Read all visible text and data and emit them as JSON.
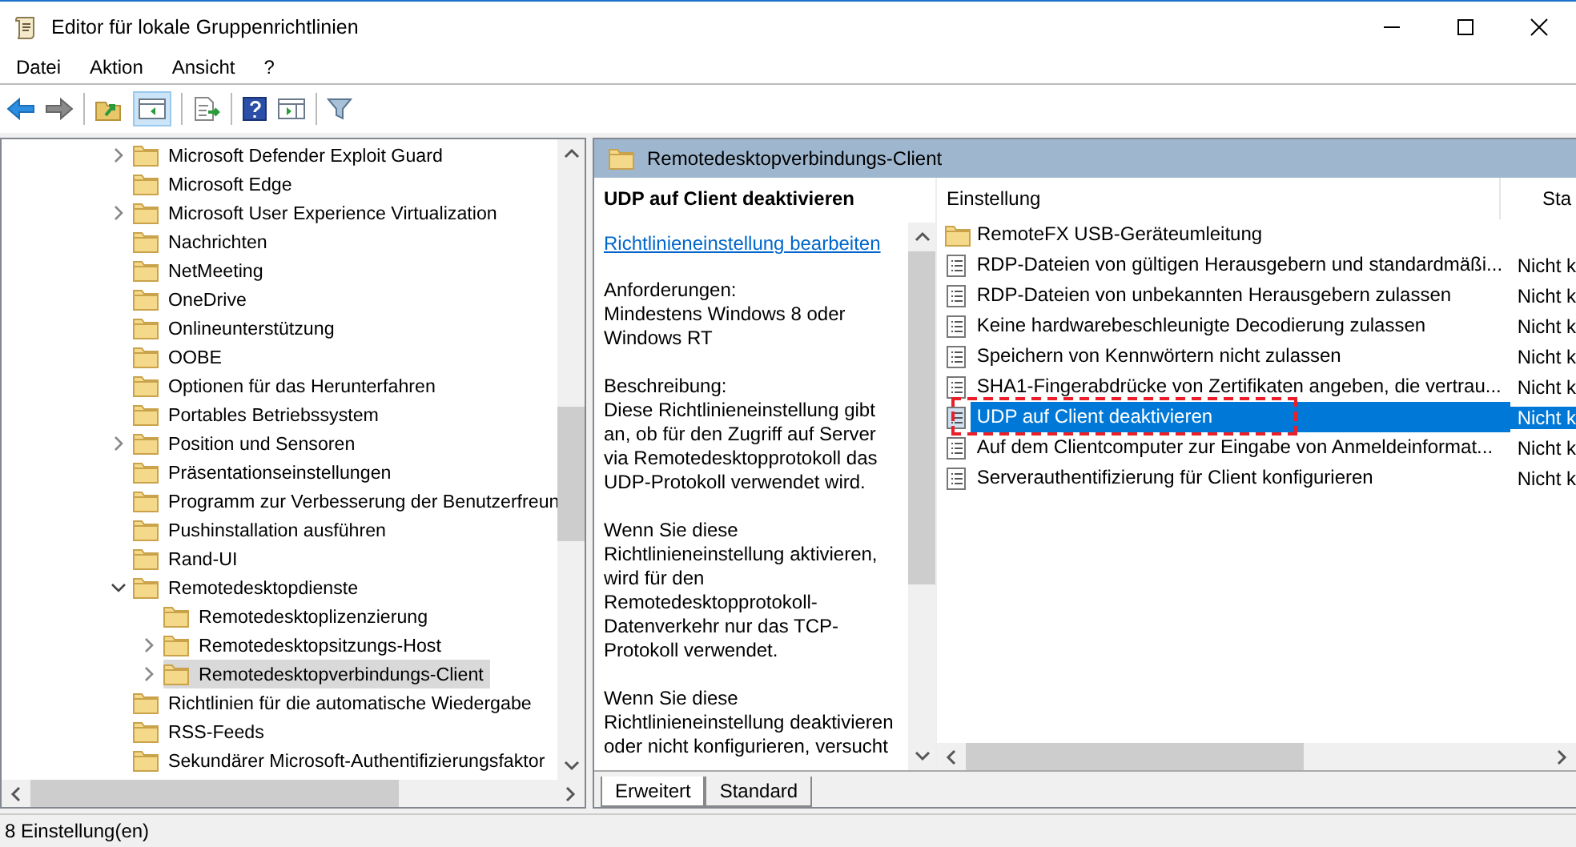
{
  "window": {
    "title": "Editor für lokale Gruppenrichtlinien"
  },
  "menu": [
    "Datei",
    "Aktion",
    "Ansicht",
    "?"
  ],
  "tree": {
    "items": [
      {
        "label": "Microsoft Defender Exploit Guard",
        "expandable": true,
        "expanded": false,
        "selected": false
      },
      {
        "label": "Microsoft Edge",
        "expandable": false,
        "selected": false
      },
      {
        "label": "Microsoft User Experience Virtualization",
        "expandable": true,
        "expanded": false,
        "selected": false
      },
      {
        "label": "Nachrichten",
        "expandable": false,
        "selected": false
      },
      {
        "label": "NetMeeting",
        "expandable": false,
        "selected": false
      },
      {
        "label": "OneDrive",
        "expandable": false,
        "selected": false
      },
      {
        "label": "Onlineunterstützung",
        "expandable": false,
        "selected": false
      },
      {
        "label": "OOBE",
        "expandable": false,
        "selected": false
      },
      {
        "label": "Optionen für das Herunterfahren",
        "expandable": false,
        "selected": false
      },
      {
        "label": "Portables Betriebssystem",
        "expandable": false,
        "selected": false
      },
      {
        "label": "Position und Sensoren",
        "expandable": true,
        "expanded": false,
        "selected": false
      },
      {
        "label": "Präsentationseinstellungen",
        "expandable": false,
        "selected": false
      },
      {
        "label": "Programm zur Verbesserung der Benutzerfreun",
        "expandable": false,
        "selected": false
      },
      {
        "label": "Pushinstallation ausführen",
        "expandable": false,
        "selected": false
      },
      {
        "label": "Rand-UI",
        "expandable": false,
        "selected": false
      },
      {
        "label": "Remotedesktopdienste",
        "expandable": true,
        "expanded": true,
        "selected": false,
        "children": [
          {
            "label": "Remotedesktoplizenzierung",
            "expandable": false,
            "selected": false
          },
          {
            "label": "Remotedesktopsitzungs-Host",
            "expandable": true,
            "expanded": false,
            "selected": false
          },
          {
            "label": "Remotedesktopverbindungs-Client",
            "expandable": true,
            "expanded": false,
            "selected": true
          }
        ]
      },
      {
        "label": "Richtlinien für die automatische Wiedergabe",
        "expandable": false,
        "selected": false
      },
      {
        "label": "RSS-Feeds",
        "expandable": false,
        "selected": false
      },
      {
        "label": "Sekundärer Microsoft-Authentifizierungsfaktor",
        "expandable": false,
        "selected": false
      }
    ]
  },
  "details": {
    "header": "Remotedesktopverbindungs-Client",
    "policy_title": "UDP auf Client deaktivieren",
    "edit_link": "Richtlinieneinstellung bearbeiten",
    "paragraphs": [
      "Anforderungen:\nMindestens Windows 8 oder\nWindows RT",
      "Beschreibung:\nDiese Richtlinieneinstellung gibt\nan, ob für den Zugriff auf Server\nvia Remotedesktopprotokoll das\nUDP-Protokoll verwendet wird.",
      "Wenn Sie diese\nRichtlinieneinstellung aktivieren,\nwird für den\nRemotedesktopprotokoll-\nDatenverkehr nur das TCP-\nProtokoll verwendet.",
      "Wenn Sie diese\nRichtlinieneinstellung deaktivieren\noder nicht konfigurieren, versucht"
    ]
  },
  "list": {
    "columns": [
      "Einstellung",
      "Sta"
    ],
    "rows": [
      {
        "kind": "folder",
        "name": "RemoteFX USB-Geräteumleitung",
        "selected": false,
        "highlighted": false
      },
      {
        "kind": "policy",
        "name": "RDP-Dateien von gültigen Herausgebern und standardmäßi...",
        "state": "Nicht k",
        "selected": false,
        "highlighted": false
      },
      {
        "kind": "policy",
        "name": "RDP-Dateien von unbekannten Herausgebern zulassen",
        "state": "Nicht k",
        "selected": false,
        "highlighted": false
      },
      {
        "kind": "policy",
        "name": "Keine hardwarebeschleunigte Decodierung zulassen",
        "state": "Nicht k",
        "selected": false,
        "highlighted": false
      },
      {
        "kind": "policy",
        "name": "Speichern von Kennwörtern nicht zulassen",
        "state": "Nicht k",
        "selected": false,
        "highlighted": false
      },
      {
        "kind": "policy",
        "name": "SHA1-Fingerabdrücke von Zertifikaten angeben, die vertrau...",
        "state": "Nicht k",
        "selected": false,
        "highlighted": false
      },
      {
        "kind": "policy",
        "name": "UDP auf Client deaktivieren",
        "state": "Nicht k",
        "selected": true,
        "highlighted": true
      },
      {
        "kind": "policy",
        "name": "Auf dem Clientcomputer zur Eingabe von Anmeldeinformat...",
        "state": "Nicht k",
        "selected": false,
        "highlighted": false
      },
      {
        "kind": "policy",
        "name": "Serverauthentifizierung für Client konfigurieren",
        "state": "Nicht k",
        "selected": false,
        "highlighted": false
      }
    ]
  },
  "tabs": [
    {
      "label": "Erweitert",
      "selected": true
    },
    {
      "label": "Standard",
      "selected": false
    }
  ],
  "status_bar": "8 Einstellung(en)"
}
